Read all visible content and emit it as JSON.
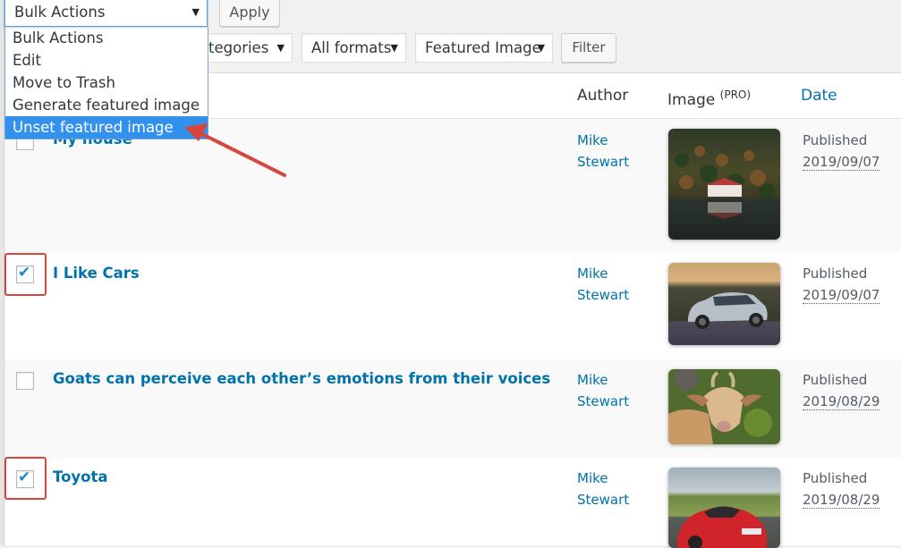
{
  "tablenav": {
    "bulk_select_value": "Bulk Actions",
    "apply_label": "Apply",
    "categories_select_value": "All Categories",
    "categories_visible_text": "tegories",
    "formats_select_value": "All formats",
    "featured_select_value": "Featured Image",
    "filter_label": "Filter"
  },
  "bulk_dropdown": {
    "items": [
      {
        "label": "Bulk Actions",
        "selected": false
      },
      {
        "label": "Edit",
        "selected": false
      },
      {
        "label": "Move to Trash",
        "selected": false
      },
      {
        "label": "Generate featured image",
        "selected": false
      },
      {
        "label": "Unset featured image",
        "selected": true
      }
    ]
  },
  "table": {
    "headers": {
      "author": "Author",
      "image": "Image",
      "image_badge": "(PRO)",
      "date": "Date"
    },
    "rows": [
      {
        "title": "My house",
        "checked": false,
        "author_first": "Mike",
        "author_last": "Stewart",
        "status": "Published",
        "date": "2019/09/07",
        "thumbnail": "lake-house-forest"
      },
      {
        "title": "I Like Cars",
        "checked": true,
        "author_first": "Mike",
        "author_last": "Stewart",
        "status": "Published",
        "date": "2019/09/07",
        "thumbnail": "silver-suv-road"
      },
      {
        "title": "Goats can perceive each other’s emotions from their voices",
        "checked": false,
        "author_first": "Mike",
        "author_last": "Stewart",
        "status": "Published",
        "date": "2019/08/29",
        "thumbnail": "goat-portrait"
      },
      {
        "title": "Toyota",
        "checked": true,
        "author_first": "Mike",
        "author_last": "Stewart",
        "status": "Published",
        "date": "2019/08/29",
        "thumbnail": "red-sports-car"
      }
    ]
  },
  "colors": {
    "link": "#0073aa",
    "highlight": "#3391ee",
    "annotation": "#d9453b"
  }
}
